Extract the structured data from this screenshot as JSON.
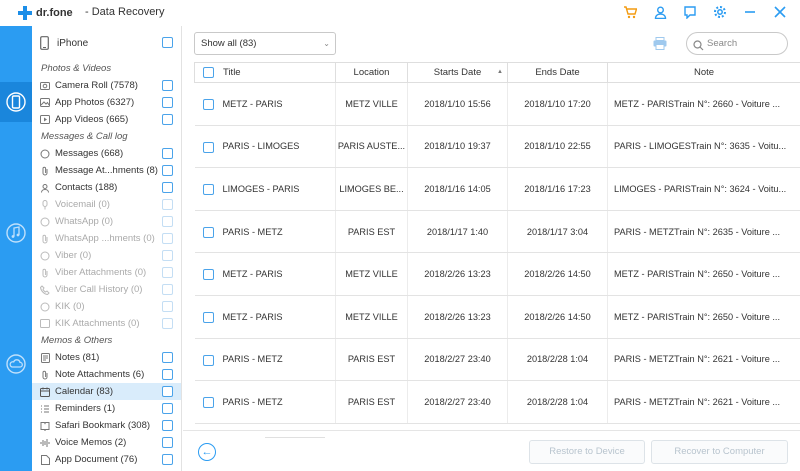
{
  "app": {
    "logo_text": "dr.fone",
    "title": "- Data Recovery"
  },
  "titlebar_icons": [
    "cart-icon",
    "user-icon",
    "feedback-icon",
    "settings-icon",
    "minimize-icon",
    "close-icon"
  ],
  "device": {
    "name": "iPhone"
  },
  "sidebar": {
    "photos_header": "Photos & Videos",
    "camera_roll": "Camera Roll (7578)",
    "app_photos": "App Photos (6327)",
    "app_videos": "App Videos (665)",
    "messages_header": "Messages & Call log",
    "messages": "Messages (668)",
    "message_attachments": "Message At...hments (8)",
    "contacts": "Contacts (188)",
    "voicemail": "Voicemail (0)",
    "whatsapp": "WhatsApp (0)",
    "whatsapp_attachments": "WhatsApp ...hments (0)",
    "viber": "Viber (0)",
    "viber_attachments": "Viber Attachments (0)",
    "viber_calls": "Viber Call History (0)",
    "kik": "KIK (0)",
    "kik_attachments": "KIK Attachments (0)",
    "memos_header": "Memos & Others",
    "notes": "Notes (81)",
    "note_attachments": "Note Attachments (6)",
    "calendar": "Calendar (83)",
    "reminders": "Reminders (1)",
    "safari": "Safari Bookmark (308)",
    "voice_memos": "Voice Memos (2)",
    "app_document": "App Document (76)"
  },
  "toolbar": {
    "filter": "Show all (83)",
    "search_placeholder": "Search"
  },
  "table": {
    "headers": {
      "title": "Title",
      "location": "Location",
      "starts": "Starts Date",
      "ends": "Ends Date",
      "note": "Note"
    },
    "rows": [
      {
        "title": "METZ - PARIS",
        "location": "METZ VILLE",
        "starts": "2018/1/10 15:56",
        "ends": "2018/1/10 17:20",
        "note": "METZ - PARISTrain N°: 2660 - Voiture ..."
      },
      {
        "title": "PARIS - LIMOGES",
        "location": "PARIS AUSTE...",
        "starts": "2018/1/10 19:37",
        "ends": "2018/1/10 22:55",
        "note": "PARIS - LIMOGESTrain N°: 3635 - Voitu..."
      },
      {
        "title": "LIMOGES - PARIS",
        "location": "LIMOGES BE...",
        "starts": "2018/1/16 14:05",
        "ends": "2018/1/16 17:23",
        "note": "LIMOGES - PARISTrain N°: 3624 - Voitu..."
      },
      {
        "title": "PARIS - METZ",
        "location": "PARIS EST",
        "starts": "2018/1/17 1:40",
        "ends": "2018/1/17 3:04",
        "note": "PARIS - METZTrain N°: 2635 - Voiture ..."
      },
      {
        "title": "METZ - PARIS",
        "location": "METZ VILLE",
        "starts": "2018/2/26 13:23",
        "ends": "2018/2/26 14:50",
        "note": "METZ - PARISTrain N°: 2650 - Voiture ..."
      },
      {
        "title": "METZ - PARIS",
        "location": "METZ VILLE",
        "starts": "2018/2/26 13:23",
        "ends": "2018/2/26 14:50",
        "note": "METZ - PARISTrain N°: 2650 - Voiture ..."
      },
      {
        "title": "PARIS - METZ",
        "location": "PARIS EST",
        "starts": "2018/2/27 23:40",
        "ends": "2018/2/28 1:04",
        "note": "PARIS - METZTrain N°: 2621 - Voiture ..."
      },
      {
        "title": "PARIS - METZ",
        "location": "PARIS EST",
        "starts": "2018/2/27 23:40",
        "ends": "2018/2/28 1:04",
        "note": "PARIS - METZTrain N°: 2621 - Voiture ..."
      }
    ]
  },
  "footer": {
    "restore_device": "Restore to Device",
    "recover_computer": "Recover to Computer"
  },
  "colors": {
    "accent": "#2b9cf2",
    "rail": "#2b9cf2",
    "cart": "#f39c12",
    "selected_row": "#d9ecfb"
  }
}
